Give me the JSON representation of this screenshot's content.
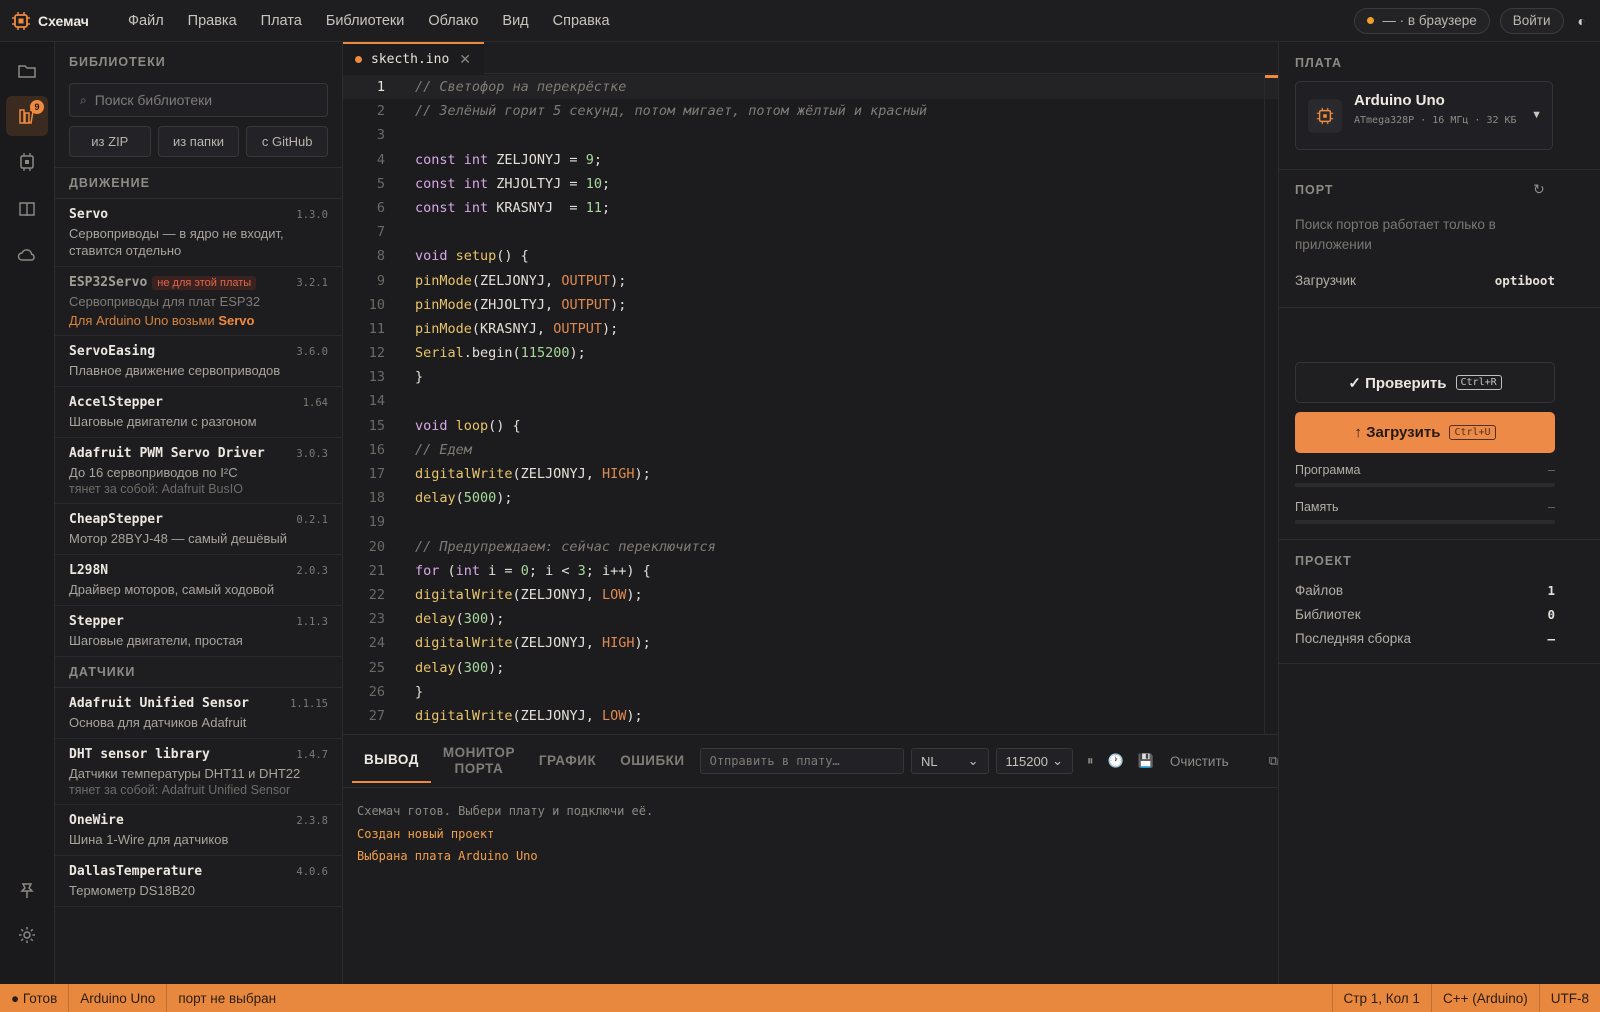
{
  "app": {
    "name": "Схемач",
    "menu": [
      "Файл",
      "Правка",
      "Плата",
      "Библиотеки",
      "Облако",
      "Вид",
      "Справка"
    ],
    "mode_pill": "— · в браузере",
    "login": "Войти",
    "theme_icon": "◐",
    "accent": "#f08a3e"
  },
  "activity": {
    "library_badge": "9"
  },
  "libraries": {
    "title": "БИБЛИОТЕКИ",
    "search_placeholder": "Поиск библиотеки",
    "buttons": [
      "из ZIP",
      "из папки",
      "с GitHub"
    ],
    "categories": [
      {
        "name": "ДВИЖЕНИЕ",
        "items": [
          {
            "name": "Servo",
            "version": "1.3.0",
            "desc": "Сервоприводы — в ядро не входит, ставится отдельно"
          },
          {
            "name": "ESP32Servo",
            "version": "3.2.1",
            "warn": "не для этой платы",
            "desc": "Сервоприводы для плат ESP32",
            "hint_prefix": "Для Arduino Uno возьми ",
            "hint_lib": "Servo"
          },
          {
            "name": "ServoEasing",
            "version": "3.6.0",
            "desc": "Плавное движение сервоприводов"
          },
          {
            "name": "AccelStepper",
            "version": "1.64",
            "desc": "Шаговые двигатели с разгоном"
          },
          {
            "name": "Adafruit PWM Servo Driver",
            "version": "3.0.3",
            "desc": "До 16 сервоприводов по I²C",
            "dep": "тянет за собой: Adafruit BusIO"
          },
          {
            "name": "CheapStepper",
            "version": "0.2.1",
            "desc": "Мотор 28BYJ-48 — самый дешёвый"
          },
          {
            "name": "L298N",
            "version": "2.0.3",
            "desc": "Драйвер моторов, самый ходовой"
          },
          {
            "name": "Stepper",
            "version": "1.1.3",
            "desc": "Шаговые двигатели, простая"
          }
        ]
      },
      {
        "name": "ДАТЧИКИ",
        "items": [
          {
            "name": "Adafruit Unified Sensor",
            "version": "1.1.15",
            "desc": "Основа для датчиков Adafruit"
          },
          {
            "name": "DHT sensor library",
            "version": "1.4.7",
            "desc": "Датчики температуры DHT11 и DHT22",
            "dep": "тянет за собой: Adafruit Unified Sensor"
          },
          {
            "name": "OneWire",
            "version": "2.3.8",
            "desc": "Шина 1-Wire для датчиков"
          },
          {
            "name": "DallasTemperature",
            "version": "4.0.6",
            "desc": "Термометр DS18B20"
          }
        ]
      }
    ]
  },
  "editor": {
    "tab_name": "skecth.ino",
    "current_line": 1,
    "lines": [
      {
        "n": "1",
        "parts": [
          [
            "c-com",
            "// Светофор на перекрёстке"
          ]
        ]
      },
      {
        "n": "2",
        "parts": [
          [
            "c-com",
            "// Зелёный горит 5 секунд, потом мигает, потом жёлтый и красный"
          ]
        ]
      },
      {
        "n": "3",
        "parts": []
      },
      {
        "n": "4",
        "parts": [
          [
            "c-kw",
            "const int "
          ],
          [
            "",
            "ZELJONYJ = "
          ],
          [
            "c-num",
            "9"
          ],
          [
            "",
            ";"
          ]
        ]
      },
      {
        "n": "5",
        "parts": [
          [
            "c-kw",
            "const int "
          ],
          [
            "",
            "ZHJOLTYJ = "
          ],
          [
            "c-num",
            "10"
          ],
          [
            "",
            ";"
          ]
        ]
      },
      {
        "n": "6",
        "parts": [
          [
            "c-kw",
            "const int "
          ],
          [
            "",
            "KRASNYJ  = "
          ],
          [
            "c-num",
            "11"
          ],
          [
            "",
            ";"
          ]
        ]
      },
      {
        "n": "7",
        "parts": []
      },
      {
        "n": "8",
        "parts": [
          [
            "c-kw",
            "void "
          ],
          [
            "c-fn",
            "setup"
          ],
          [
            "",
            "() {"
          ]
        ]
      },
      {
        "n": "9",
        "parts": [
          [
            "c-fn",
            "pinMode"
          ],
          [
            "",
            "(ZELJONYJ, "
          ],
          [
            "c-const",
            "OUTPUT"
          ],
          [
            "",
            ");"
          ]
        ]
      },
      {
        "n": "10",
        "parts": [
          [
            "c-fn",
            "pinMode"
          ],
          [
            "",
            "(ZHJOLTYJ, "
          ],
          [
            "c-const",
            "OUTPUT"
          ],
          [
            "",
            ");"
          ]
        ]
      },
      {
        "n": "11",
        "parts": [
          [
            "c-fn",
            "pinMode"
          ],
          [
            "",
            "(KRASNYJ, "
          ],
          [
            "c-const",
            "OUTPUT"
          ],
          [
            "",
            ");"
          ]
        ]
      },
      {
        "n": "12",
        "parts": [
          [
            "c-fn",
            "Serial"
          ],
          [
            "",
            ".begin("
          ],
          [
            "c-num",
            "115200"
          ],
          [
            "",
            ");"
          ]
        ]
      },
      {
        "n": "13",
        "parts": [
          [
            "",
            "}"
          ]
        ]
      },
      {
        "n": "14",
        "parts": []
      },
      {
        "n": "15",
        "parts": [
          [
            "c-kw",
            "void "
          ],
          [
            "c-fn",
            "loop"
          ],
          [
            "",
            "() {"
          ]
        ]
      },
      {
        "n": "16",
        "parts": [
          [
            "c-com",
            "// Едем"
          ]
        ]
      },
      {
        "n": "17",
        "parts": [
          [
            "c-fn",
            "digitalWrite"
          ],
          [
            "",
            "(ZELJONYJ, "
          ],
          [
            "c-const",
            "HIGH"
          ],
          [
            "",
            ");"
          ]
        ]
      },
      {
        "n": "18",
        "parts": [
          [
            "c-fn",
            "delay"
          ],
          [
            "",
            "("
          ],
          [
            "c-num",
            "5000"
          ],
          [
            "",
            ");"
          ]
        ]
      },
      {
        "n": "19",
        "parts": []
      },
      {
        "n": "20",
        "parts": [
          [
            "c-com",
            "// Предупреждаем: сейчас переключится"
          ]
        ]
      },
      {
        "n": "21",
        "parts": [
          [
            "c-kw",
            "for "
          ],
          [
            "",
            "("
          ],
          [
            "c-kw",
            "int "
          ],
          [
            "",
            "i = "
          ],
          [
            "c-num",
            "0"
          ],
          [
            "",
            "; i < "
          ],
          [
            "c-num",
            "3"
          ],
          [
            "",
            "; i++) {"
          ]
        ]
      },
      {
        "n": "22",
        "parts": [
          [
            "c-fn",
            "digitalWrite"
          ],
          [
            "",
            "(ZELJONYJ, "
          ],
          [
            "c-const",
            "LOW"
          ],
          [
            "",
            ");"
          ]
        ]
      },
      {
        "n": "23",
        "parts": [
          [
            "c-fn",
            "delay"
          ],
          [
            "",
            "("
          ],
          [
            "c-num",
            "300"
          ],
          [
            "",
            ");"
          ]
        ]
      },
      {
        "n": "24",
        "parts": [
          [
            "c-fn",
            "digitalWrite"
          ],
          [
            "",
            "(ZELJONYJ, "
          ],
          [
            "c-const",
            "HIGH"
          ],
          [
            "",
            ");"
          ]
        ]
      },
      {
        "n": "25",
        "parts": [
          [
            "c-fn",
            "delay"
          ],
          [
            "",
            "("
          ],
          [
            "c-num",
            "300"
          ],
          [
            "",
            ");"
          ]
        ]
      },
      {
        "n": "26",
        "parts": [
          [
            "",
            "}"
          ]
        ]
      },
      {
        "n": "27",
        "parts": [
          [
            "c-fn",
            "digitalWrite"
          ],
          [
            "",
            "(ZELJONYJ, "
          ],
          [
            "c-const",
            "LOW"
          ],
          [
            "",
            ");"
          ]
        ]
      }
    ]
  },
  "output": {
    "tabs": [
      "ВЫВОД",
      "МОНИТОР ПОРТА",
      "ГРАФИК",
      "ОШИБКИ"
    ],
    "send_placeholder": "Отправить в плату…",
    "line_ending": "NL",
    "baud": "115200",
    "clear": "Очистить",
    "log": [
      {
        "kind": "plain",
        "text": "Схемач готов. Выбери плату и подключи её."
      },
      {
        "kind": "event",
        "text": "Создан новый проект"
      },
      {
        "kind": "event",
        "text": "Выбрана плата Arduino Uno"
      }
    ]
  },
  "board_panel": {
    "title": "ПЛАТА",
    "board_name": "Arduino Uno",
    "board_desc": "ATmega328P · 16 МГц · 32 КБ",
    "port_title": "ПОРТ",
    "port_note": "Поиск портов работает только в приложении",
    "bootloader_label": "Загрузчик",
    "bootloader_value": "optiboot",
    "verify_label": "✓ Проверить",
    "verify_kbd": "Ctrl+R",
    "upload_label": "↑ Загрузить",
    "upload_kbd": "Ctrl+U",
    "program_label": "Программа",
    "program_value": "–",
    "memory_label": "Память",
    "memory_value": "–",
    "project_title": "ПРОЕКТ",
    "files_label": "Файлов",
    "files_value": "1",
    "libs_label": "Библиотек",
    "libs_value": "0",
    "last_build_label": "Последняя сборка",
    "last_build_value": "–"
  },
  "status": {
    "ready": "● Готов",
    "board": "Arduino Uno",
    "port": "порт не выбран",
    "cursor": "Стр 1, Кол 1",
    "language": "C++ (Arduino)",
    "encoding": "UTF-8"
  }
}
